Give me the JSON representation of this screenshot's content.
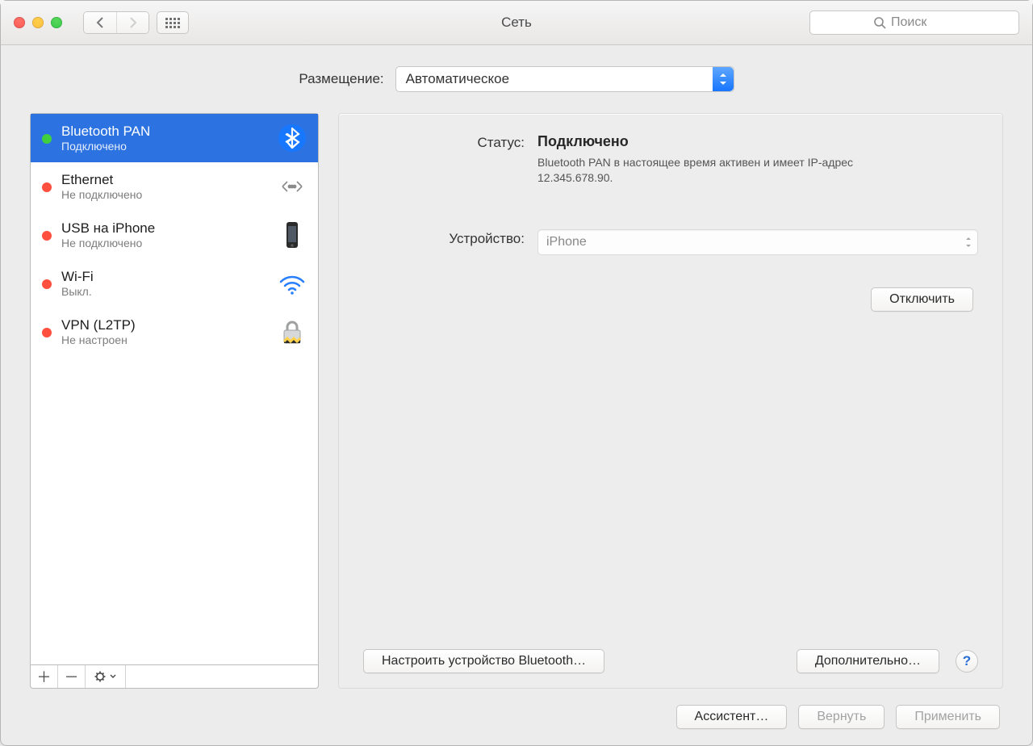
{
  "window_title": "Сеть",
  "search_placeholder": "Поиск",
  "location_label": "Размещение:",
  "location_value": "Автоматическое",
  "services": [
    {
      "name": "Bluetooth PAN",
      "status": "Подключено",
      "dot": "green",
      "icon": "bluetooth",
      "selected": true
    },
    {
      "name": "Ethernet",
      "status": "Не подключено",
      "dot": "red",
      "icon": "ethernet",
      "selected": false
    },
    {
      "name": "USB на iPhone",
      "status": "Не подключено",
      "dot": "red",
      "icon": "iphone",
      "selected": false
    },
    {
      "name": "Wi-Fi",
      "status": "Выкл.",
      "dot": "red",
      "icon": "wifi",
      "selected": false
    },
    {
      "name": "VPN (L2TP)",
      "status": "Не настроен",
      "dot": "red",
      "icon": "lock",
      "selected": false
    }
  ],
  "detail": {
    "status_label": "Статус:",
    "status_value": "Подключено",
    "status_desc": "Bluetooth PAN в настоящее время активен и имеет IP-адрес 12.345.678.90.",
    "device_label": "Устройство:",
    "device_value": "iPhone",
    "disconnect_button": "Отключить",
    "setup_button": "Настроить устройство Bluetooth…",
    "advanced_button": "Дополнительно…"
  },
  "footer": {
    "assistant": "Ассистент…",
    "revert": "Вернуть",
    "apply": "Применить"
  }
}
